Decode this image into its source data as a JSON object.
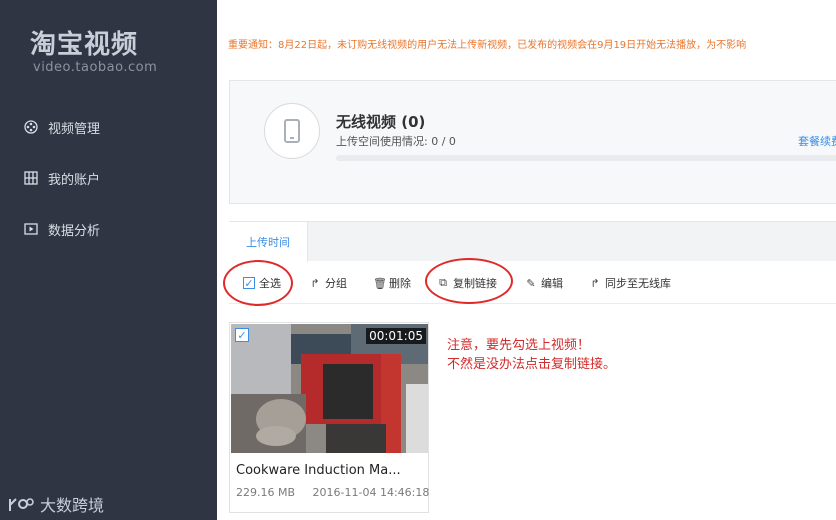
{
  "sidebar": {
    "logo": "淘宝视频",
    "logo_sub": "video.taobao.com",
    "items": [
      {
        "label": "视频管理",
        "icon": "film-reel-icon"
      },
      {
        "label": "我的账户",
        "icon": "account-grid-icon"
      },
      {
        "label": "数据分析",
        "icon": "play-box-icon"
      }
    ],
    "watermark": "大数跨境"
  },
  "notice": "重要通知：8月22日起，未订购无线视频的用户无法上传新视频，已发布的视频会在9月19日开始无法播放，为不影响",
  "stats": {
    "title": "无线视频 (0)",
    "usage_label": "上传空间使用情况: 0 / 0",
    "usage_fraction": 0,
    "link": "套餐续费",
    "icon": "phone-icon"
  },
  "tabs": [
    {
      "label": "上传时间",
      "active": true
    }
  ],
  "toolbar": {
    "select_all": "全选",
    "group": "分组",
    "delete": "删除",
    "copy_link": "复制链接",
    "edit": "编辑",
    "sync": "同步至无线库"
  },
  "videos": [
    {
      "title": "Cookware Induction Ma...",
      "size": "229.16 MB",
      "date": "2016-11-04 14:46:18",
      "duration": "00:01:05",
      "checked": true
    }
  ],
  "annotation": {
    "line1": "注意，要先勾选上视频！",
    "line2": "不然是没办法点击复制链接。"
  },
  "colors": {
    "sidebar_bg": "#2f3542",
    "accent": "#3a8ee6",
    "notice": "#e8762d",
    "annotation": "#d22a2a"
  }
}
